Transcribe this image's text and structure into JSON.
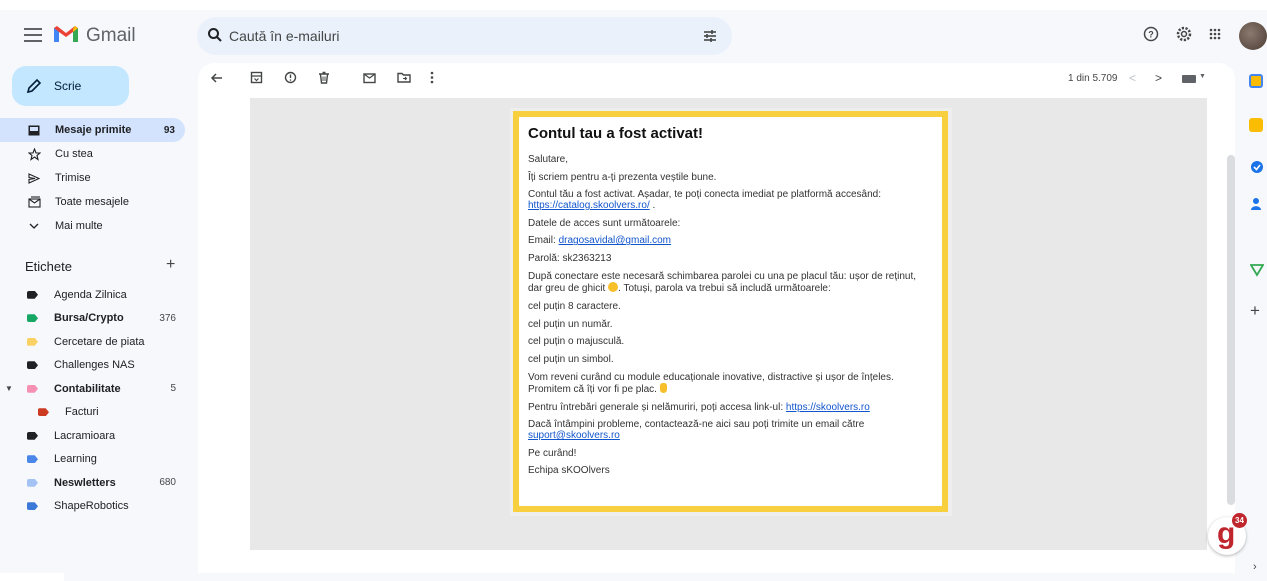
{
  "app": {
    "name": "Gmail"
  },
  "search": {
    "placeholder": "Caută în e-mailuri"
  },
  "compose": {
    "label": "Scrie"
  },
  "nav": [
    {
      "label": "Mesaje primite",
      "count": "93",
      "icon": "inbox-icon",
      "active": true
    },
    {
      "label": "Cu stea",
      "count": "",
      "icon": "star-icon"
    },
    {
      "label": "Trimise",
      "count": "",
      "icon": "send-icon"
    },
    {
      "label": "Toate mesajele",
      "count": "",
      "icon": "all-mail-icon"
    },
    {
      "label": "Mai multe",
      "count": "",
      "icon": "chevron-down-icon"
    }
  ],
  "labels": {
    "header": "Etichete",
    "items": [
      {
        "label": "Agenda Zilnica",
        "count": "",
        "color": "#202124",
        "bold": false
      },
      {
        "label": "Bursa/Crypto",
        "count": "376",
        "color": "#16a765",
        "bold": true
      },
      {
        "label": "Cercetare de piata",
        "count": "",
        "color": "#fad165",
        "bold": false
      },
      {
        "label": "Challenges NAS",
        "count": "",
        "color": "#202124",
        "bold": false
      },
      {
        "label": "Contabilitate",
        "count": "5",
        "color": "#f691b3",
        "bold": true
      },
      {
        "label": "Facturi",
        "count": "",
        "color": "#cc3a21",
        "bold": false
      },
      {
        "label": "Lacramioara",
        "count": "",
        "color": "#202124",
        "bold": false
      },
      {
        "label": "Learning",
        "count": "",
        "color": "#4a86e8",
        "bold": false
      },
      {
        "label": "Neswletters",
        "count": "680",
        "color": "#a4c2f4",
        "bold": true
      },
      {
        "label": "ShapeRobotics",
        "count": "",
        "color": "#3c78d8",
        "bold": false
      }
    ]
  },
  "pager": {
    "text": "1 din 5.709"
  },
  "email": {
    "title": "Contul tau a fost activat!",
    "greeting": "Salutare,",
    "line1": "Îți scriem pentru a-ți prezenta veștile bune.",
    "line2": "Contul tău a fost activat. Așadar, te poți conecta imediat pe platformă accesând:",
    "catalog_link": "https://catalog.skoolvers.ro/",
    "line3": "Datele de acces sunt următoarele:",
    "email_label": "Email:",
    "email_value": "dragosavidal@gmail.com",
    "password_label": "Parolă:",
    "password_value": "sk2363213",
    "line4a": "După conectare este necesară schimbarea parolei cu una pe placul tău: ușor de reținut, dar greu de ghicit",
    "line4b": ". Totuși, parola va trebui să includă următoarele:",
    "req1": "cel puțin 8 caractere.",
    "req2": "cel puțin un număr.",
    "req3": "cel puțin o majusculă.",
    "req4": "cel puțin un simbol.",
    "line5": "Vom reveni curând cu module educaționale inovative, distractive și ușor de înțeles. Promitem că îți vor fi pe plac.",
    "line6": "Pentru întrebări generale și nelămuriri, poți accesa link-ul:",
    "site_link": "https://skoolvers.ro",
    "line7": "Dacă întâmpini probleme, contactează-ne aici sau poți trimite un email către",
    "support_link": "suport@skoolvers.ro",
    "line8": "Pe curând!",
    "signature": "Echipa sKOOlvers"
  },
  "badge": {
    "letter": "g",
    "count": "34"
  }
}
